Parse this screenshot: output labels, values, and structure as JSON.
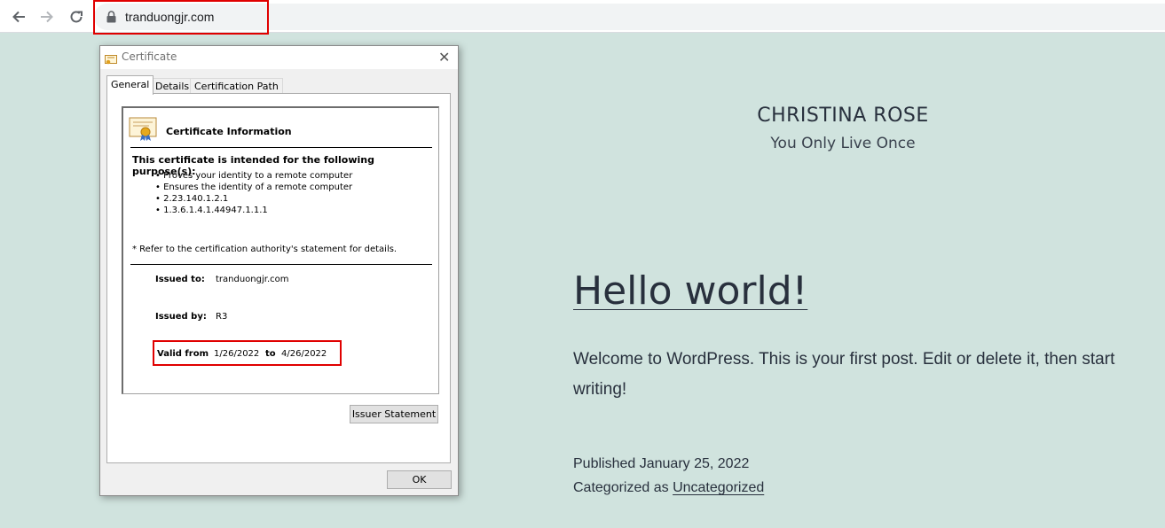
{
  "browser": {
    "url": "tranduongjr.com",
    "icons": {
      "back": "back-arrow-icon",
      "forward": "forward-arrow-icon",
      "reload": "reload-icon",
      "lock": "lock-icon"
    }
  },
  "site": {
    "title": "CHRISTINA ROSE",
    "description": "You Only Live Once"
  },
  "post": {
    "title": "Hello world!",
    "body": "Welcome to WordPress. This is your first post. Edit or delete it, then start writing!",
    "published": "Published January 25, 2022",
    "categorized_prefix": "Categorized as",
    "category": "Uncategorized"
  },
  "dialog": {
    "title": "Certificate",
    "tabs": [
      "General",
      "Details",
      "Certification Path"
    ],
    "heading": "Certificate Information",
    "purpose_heading": "This certificate is intended for the following purpose(s):",
    "purposes": [
      "Proves your identity to a remote computer",
      "Ensures the identity of a remote computer",
      "2.23.140.1.2.1",
      "1.3.6.1.4.1.44947.1.1.1"
    ],
    "refer_note": "* Refer to the certification authority's statement for details.",
    "issued_to_label": "Issued to:",
    "issued_to": "tranduongjr.com",
    "issued_by_label": "Issued by:",
    "issued_by": "R3",
    "valid_from_label": "Valid from",
    "valid_from": "1/26/2022",
    "to_label": "to",
    "valid_to": "4/26/2022",
    "issuer_statement_button": "Issuer Statement",
    "ok_button": "OK"
  },
  "colors": {
    "page_bg": "#d0e3de",
    "highlight": "#e00000",
    "text": "#28303d"
  }
}
